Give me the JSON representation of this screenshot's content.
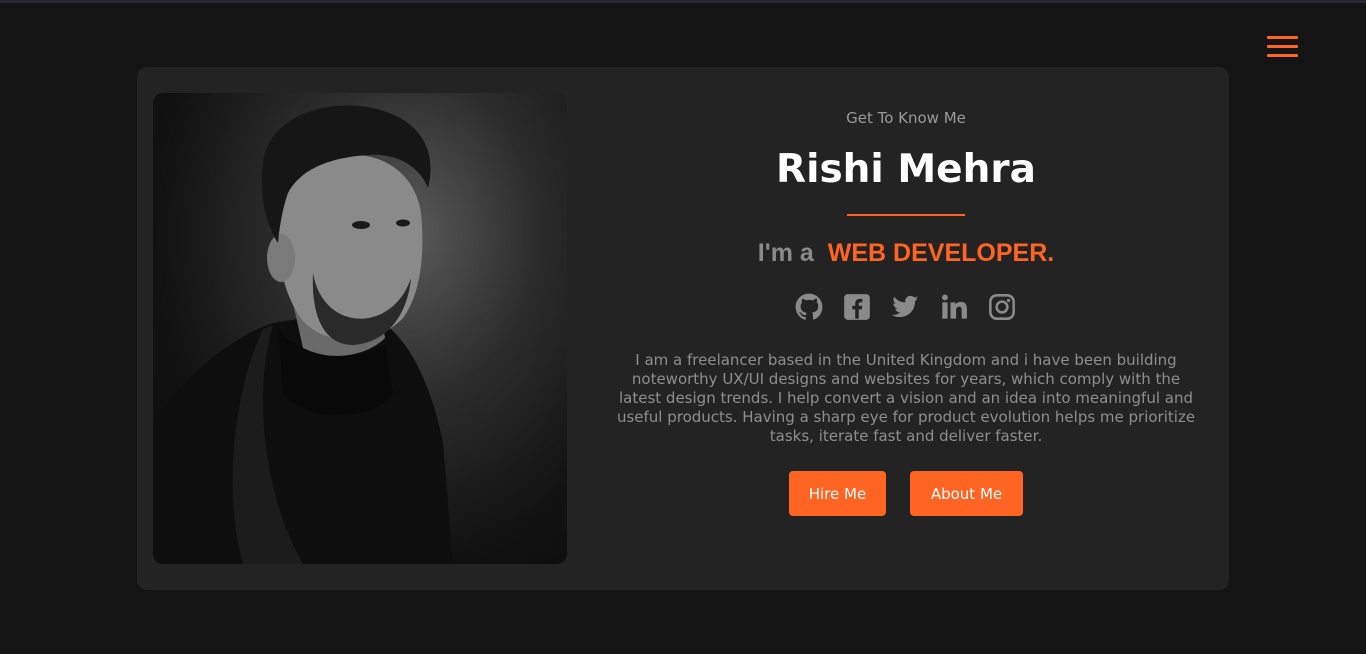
{
  "header": {
    "menu_icon": "hamburger-menu-icon",
    "accent_color": "#ff6422"
  },
  "hero": {
    "eyebrow": "Get To Know Me",
    "name": "Rishi Mehra",
    "role_prefix": "I'm a",
    "role_title": "WEB DEVELOPER.",
    "bio": "I am a freelancer based in the United Kingdom and i have been building noteworthy UX/UI designs and websites for years, which comply with the latest design trends. I help convert a vision and an idea into meaningful and useful products. Having a sharp eye for product evolution helps me prioritize tasks, iterate fast and deliver faster.",
    "socials": [
      "github-icon",
      "facebook-icon",
      "twitter-icon",
      "linkedin-icon",
      "instagram-icon"
    ],
    "buttons": {
      "hire": "Hire Me",
      "about": "About Me"
    },
    "photo_icon": "profile-photo"
  }
}
